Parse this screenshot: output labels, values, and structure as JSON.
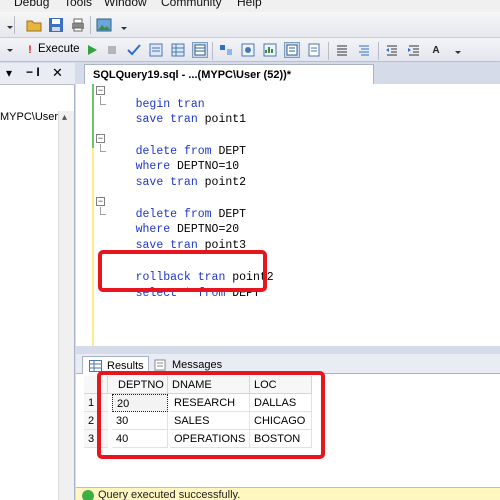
{
  "menu": {
    "items": [
      "Debug",
      "Tools",
      "Window",
      "Community",
      "Help"
    ]
  },
  "toolbar": {
    "execute_label": "Execute",
    "execute_icon": "exclamation-icon",
    "run_icon": "play-icon"
  },
  "object_explorer": {
    "pin_glyph": "− І",
    "close_glyph": "✕",
    "dropdown_glyph": "▾",
    "node_label": "MYPC\\User)",
    "scroll_glyph": "▴"
  },
  "editor": {
    "tab_title": "SQLQuery19.sql - ...(MYPC\\User (52))*",
    "lines": [
      {
        "kw1": "begin",
        "kw2": "tran",
        "rest": ""
      },
      {
        "kw1": "save",
        "kw2": "tran",
        "rest": "point1"
      },
      {
        "kw1": "delete",
        "kw2": "from",
        "rest": "DEPT"
      },
      {
        "kw1": "where",
        "kw2": "",
        "rest": "DEPTNO=10"
      },
      {
        "kw1": "save",
        "kw2": "tran",
        "rest": "point2"
      },
      {
        "kw1": "delete",
        "kw2": "from",
        "rest": "DEPT"
      },
      {
        "kw1": "where",
        "kw2": "",
        "rest": "DEPTNO=20"
      },
      {
        "kw1": "save",
        "kw2": "tran",
        "rest": "point3"
      },
      {
        "kw1": "rollback",
        "kw2": "tran",
        "rest": "point2"
      },
      {
        "kw1": "select",
        "kw2": "*",
        "kw3": "from",
        "rest": "DEPT"
      }
    ]
  },
  "results": {
    "tabs": [
      "Results",
      "Messages"
    ],
    "columns": [
      "DEPTNO",
      "DNAME",
      "LOC"
    ],
    "rows": [
      {
        "num": "1",
        "deptno": "20",
        "dname": "RESEARCH",
        "loc": "DALLAS"
      },
      {
        "num": "2",
        "deptno": "30",
        "dname": "SALES",
        "loc": "CHICAGO"
      },
      {
        "num": "3",
        "deptno": "40",
        "dname": "OPERATIONS",
        "loc": "BOSTON"
      }
    ]
  },
  "status": {
    "text": "Query executed successfully."
  },
  "colors": {
    "keyword": "#1f37c8",
    "highlight": "#e8141e",
    "status_bg": "#fff6c0"
  }
}
